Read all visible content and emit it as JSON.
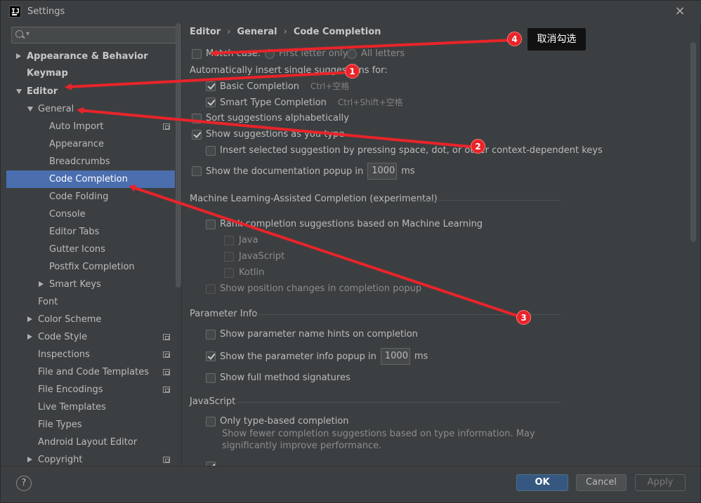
{
  "window": {
    "title": "Settings",
    "close": "×"
  },
  "sidebar": {
    "search_placeholder": "",
    "search_caret": "▾",
    "items": [
      {
        "label": "Appearance & Behavior",
        "bold": true,
        "arrow": "right"
      },
      {
        "label": "Keymap",
        "bold": true
      },
      {
        "label": "Editor",
        "bold": true,
        "arrow": "down"
      },
      {
        "label": "General",
        "arrow": "down"
      },
      {
        "label": "Auto Import",
        "icon": true
      },
      {
        "label": "Appearance"
      },
      {
        "label": "Breadcrumbs"
      },
      {
        "label": "Code Completion",
        "selected": true
      },
      {
        "label": "Code Folding"
      },
      {
        "label": "Console"
      },
      {
        "label": "Editor Tabs"
      },
      {
        "label": "Gutter Icons"
      },
      {
        "label": "Postfix Completion"
      },
      {
        "label": "Smart Keys",
        "arrow": "right"
      },
      {
        "label": "Font"
      },
      {
        "label": "Color Scheme",
        "arrow": "right"
      },
      {
        "label": "Code Style",
        "arrow": "right",
        "icon": true
      },
      {
        "label": "Inspections",
        "icon": true
      },
      {
        "label": "File and Code Templates",
        "icon": true
      },
      {
        "label": "File Encodings",
        "icon": true
      },
      {
        "label": "Live Templates"
      },
      {
        "label": "File Types"
      },
      {
        "label": "Android Layout Editor"
      },
      {
        "label": "Copyright",
        "arrow": "right",
        "icon": true
      }
    ]
  },
  "breadcrumb": [
    "Editor",
    "General",
    "Code Completion"
  ],
  "breadcrumb_sep": "›",
  "main": {
    "match_case": "Match case:",
    "first_letter": "First letter only",
    "all_letters": "All letters",
    "auto_insert": "Automatically insert single suggestions for:",
    "basic_completion": "Basic Completion",
    "basic_shortcut": "Ctrl+空格",
    "smart_completion": "Smart Type Completion",
    "smart_shortcut": "Ctrl+Shift+空格",
    "sort_alpha": "Sort suggestions alphabetically",
    "show_as_type": "Show suggestions as you type",
    "insert_selected": "Insert selected suggestion by pressing space, dot, or other context-dependent keys",
    "doc_popup": "Show the documentation popup in",
    "doc_popup_value": "1000",
    "ms": "ms",
    "ml_section": "Machine Learning-Assisted Completion (experimental)",
    "ml_rank": "Rank completion suggestions based on Machine Learning",
    "ml_java": "Java",
    "ml_js": "JavaScript",
    "ml_kotlin": "Kotlin",
    "ml_position": "Show position changes in completion popup",
    "param_section": "Parameter Info",
    "param_hints": "Show parameter name hints on completion",
    "param_popup": "Show the parameter info popup in",
    "param_popup_value": "1000",
    "param_full": "Show full method signatures",
    "js_section": "JavaScript",
    "js_type_based": "Only type-based completion",
    "js_hint_line1": "Show fewer completion suggestions based on type information. May",
    "js_hint_line2": "significantly improve performance."
  },
  "buttons": {
    "help": "?",
    "ok": "OK",
    "cancel": "Cancel",
    "apply": "Apply"
  },
  "annotations": {
    "badges": [
      "1",
      "2",
      "3",
      "4"
    ],
    "callout": "取消勾选",
    "color": "#e8242a"
  }
}
